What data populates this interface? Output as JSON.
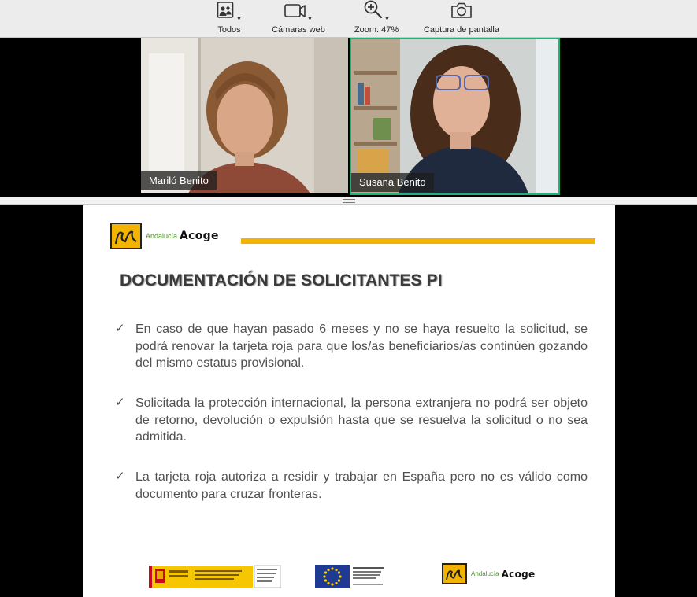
{
  "toolbar": {
    "items": [
      {
        "label": "Todos",
        "icon": "participants-gallery-icon"
      },
      {
        "label": "Cámaras web",
        "icon": "video-camera-icon"
      },
      {
        "label": "Zoom: 47%",
        "icon": "zoom-in-icon"
      },
      {
        "label": "Captura de pantalla",
        "icon": "camera-icon"
      }
    ]
  },
  "participants": [
    {
      "name": "Mariló Benito",
      "active_speaker": false
    },
    {
      "name": "Susana Benito",
      "active_speaker": true
    }
  ],
  "colors": {
    "active_border": "#1fb37a",
    "accent_bar": "#f2b400",
    "toolbar_bg": "#ececec"
  },
  "slide": {
    "logo_small": "Andalucía",
    "logo_big": "Acoge",
    "title": "DOCUMENTACIÓN DE SOLICITANTES PI",
    "bullets": [
      "En caso de que hayan pasado 6 meses y no se haya resuelto la solicitud, se podrá renovar la tarjeta roja para que los/as beneficiarios/as continúen gozando del mismo estatus provisional.",
      "Solicitada la protección internacional, la persona extranjera no podrá ser objeto de retorno, devolución o expulsión hasta que se resuelva la solicitud o no sea admitida.",
      "La tarjeta roja autoriza a residir y trabajar en España pero no es válido como documento para cruzar fronteras."
    ],
    "footer_logos": [
      "spain-government-logo",
      "european-union-logo",
      "andalucia-acoge-logo"
    ]
  }
}
